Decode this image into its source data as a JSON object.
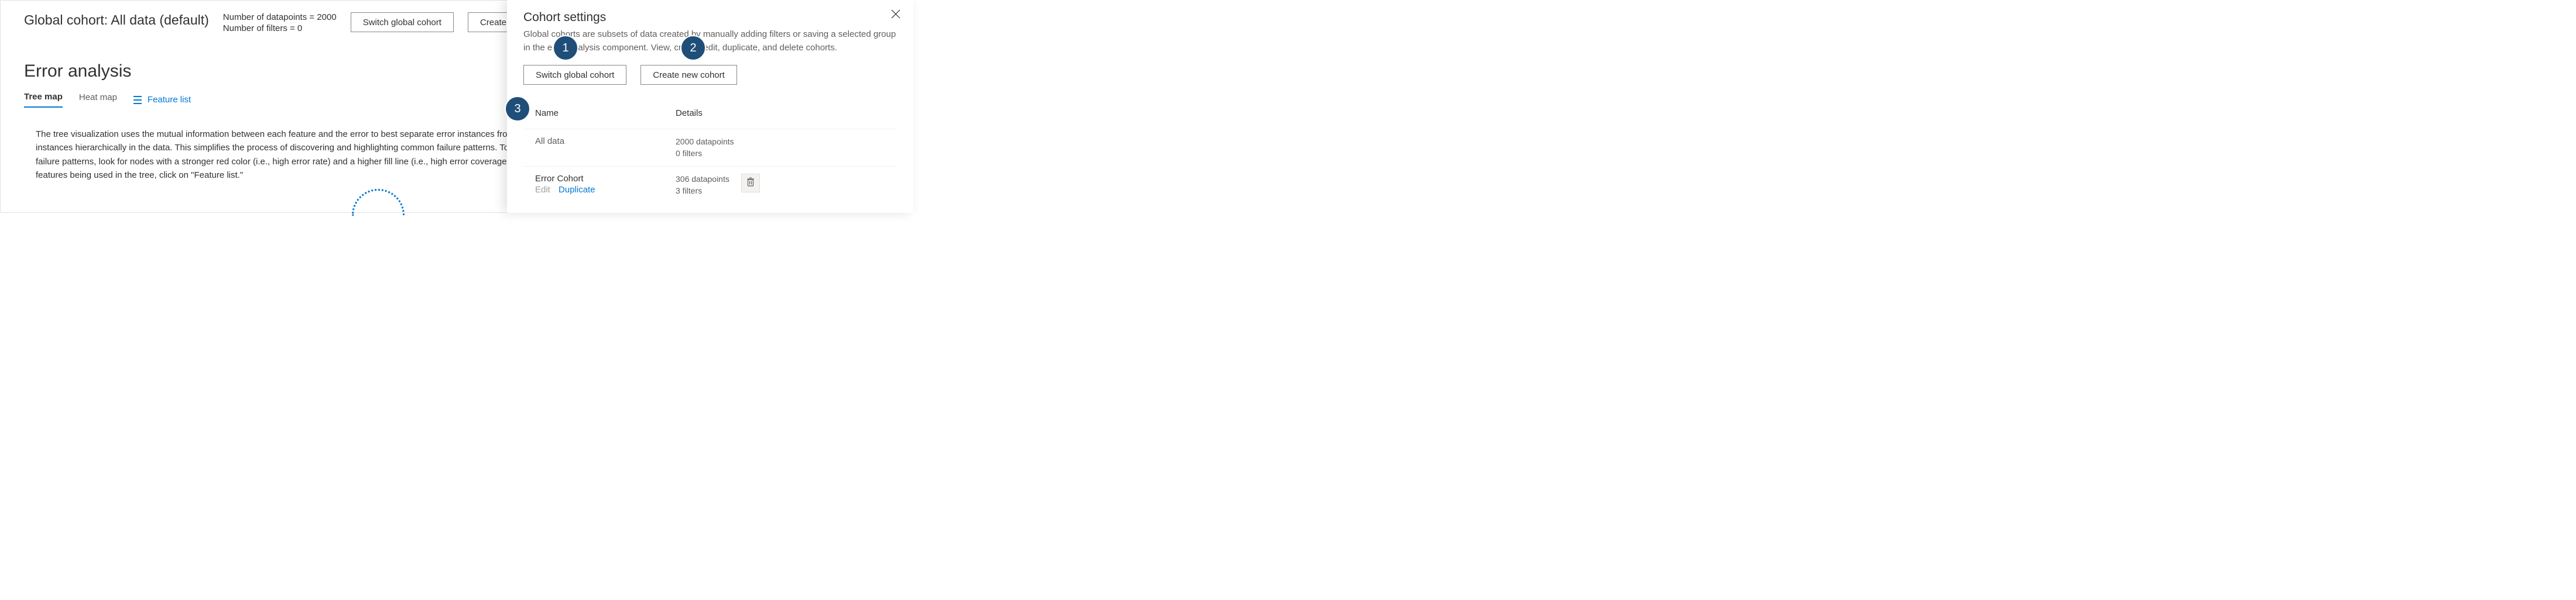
{
  "header": {
    "global_cohort_label": "Global cohort: All data (default)",
    "datapoints_line": "Number of datapoints = 2000",
    "filters_line": "Number of filters = 0",
    "switch_btn": "Switch global cohort",
    "create_btn": "Create new cohort"
  },
  "section": {
    "title": "Error analysis",
    "tab_tree": "Tree map",
    "tab_heat": "Heat map",
    "feature_list": "Feature list",
    "desc": "The tree visualization uses the mutual information between each feature and the error to best separate error instances from success instances hierarchically in the data. This simplifies the process of discovering and highlighting common failure patterns. To find important failure patterns, look for nodes with a stronger red color (i.e., high error rate) and a higher fill line (i.e., high error coverage). To edit the list of features being used in the tree, click on \"Feature list.\""
  },
  "panel": {
    "title": "Cohort settings",
    "desc": "Global cohorts are subsets of data created by manually adding filters or saving a selected group in the error analysis component. View, create, edit, duplicate, and delete cohorts.",
    "switch_btn": "Switch global cohort",
    "create_btn": "Create new cohort",
    "col_name": "Name",
    "col_details": "Details",
    "rows": [
      {
        "name": "All data",
        "datapoints": "2000 datapoints",
        "filters": "0 filters",
        "deletable": false
      },
      {
        "name": "Error Cohort",
        "datapoints": "306 datapoints",
        "filters": "3 filters",
        "deletable": true
      }
    ],
    "edit_label": "Edit",
    "duplicate_label": "Duplicate"
  },
  "badges": {
    "b1": "1",
    "b2": "2",
    "b3": "3"
  }
}
